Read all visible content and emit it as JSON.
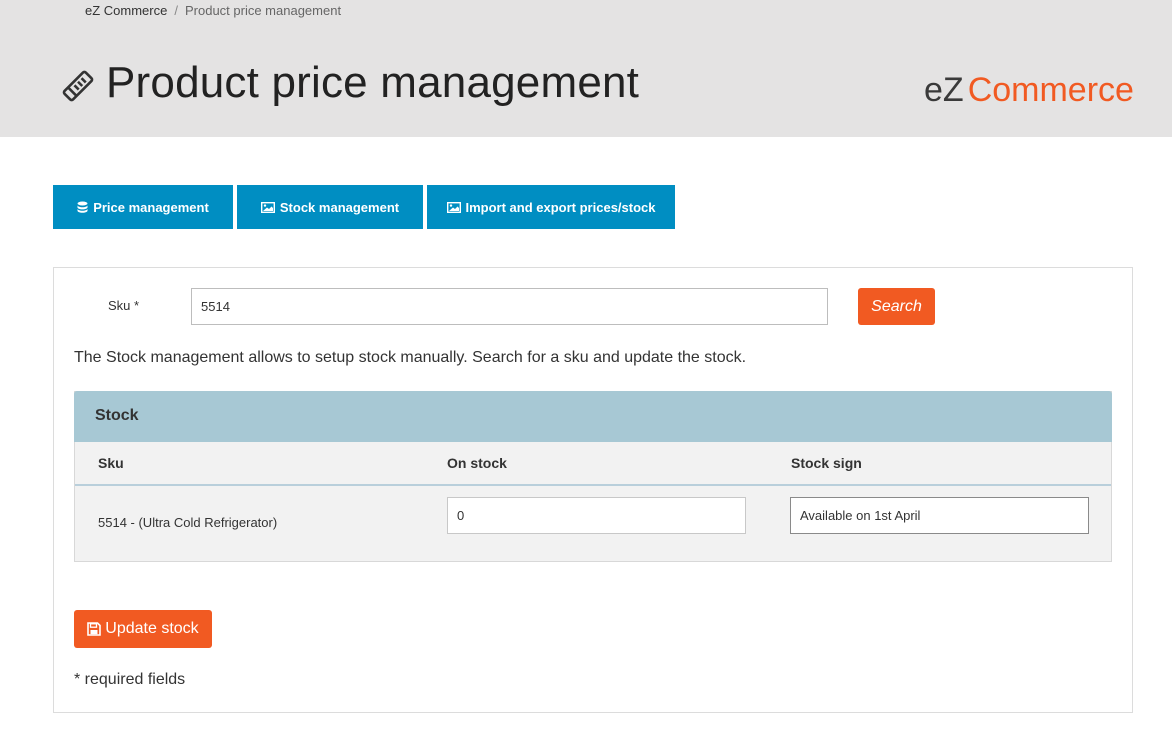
{
  "breadcrumb": {
    "home": "eZ Commerce",
    "separator": "/",
    "current": "Product price management"
  },
  "header": {
    "title": "Product price management",
    "title_icon": "tag-icon",
    "brand_ez": "eZ",
    "brand_commerce": "Commerce"
  },
  "tabs": [
    {
      "label": "Price management",
      "icon": "database-icon"
    },
    {
      "label": "Stock management",
      "icon": "image-icon"
    },
    {
      "label": "Import and export prices/stock",
      "icon": "image-icon"
    }
  ],
  "search": {
    "sku_label": "Sku *",
    "sku_value": "5514",
    "button_label": "Search"
  },
  "description": "The Stock management allows to setup stock manually. Search for a sku and update the stock.",
  "stock": {
    "title": "Stock",
    "columns": [
      "Sku",
      "On stock",
      "Stock sign"
    ],
    "rows": [
      {
        "sku": "5514 - (Ultra Cold Refrigerator)",
        "on_stock": "0",
        "stock_sign": "Available on 1st April"
      }
    ]
  },
  "update_button": {
    "label": "Update stock",
    "icon": "save-icon"
  },
  "required_note": "* required fields",
  "colors": {
    "accent_blue": "#008ec2",
    "accent_orange": "#f15a22",
    "stock_header": "#a7c8d4",
    "header_bg": "#e4e3e3"
  }
}
